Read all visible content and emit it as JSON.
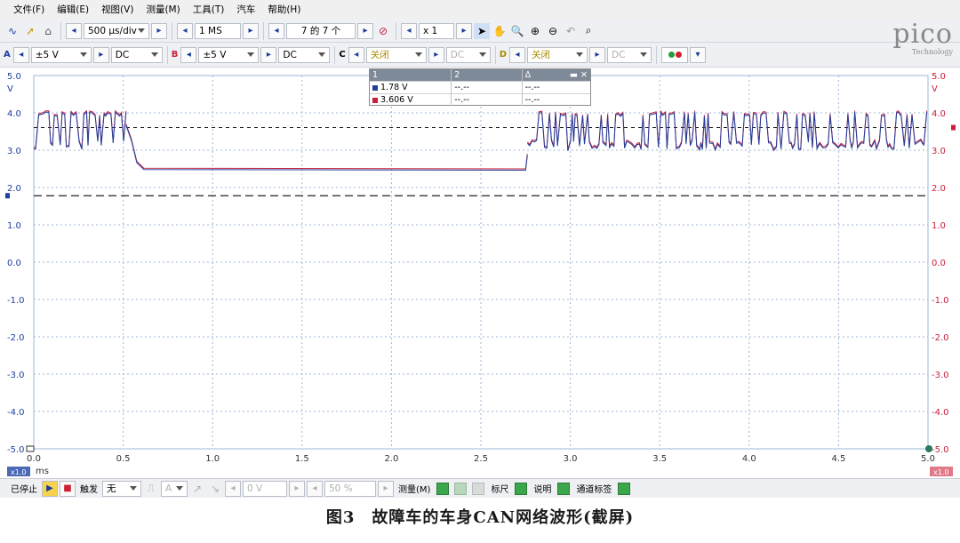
{
  "menu": [
    "文件(F)",
    "编辑(E)",
    "视图(V)",
    "测量(M)",
    "工具(T)",
    "汽车",
    "帮助(H)"
  ],
  "toolbar1": {
    "timebase": "500 µs/div",
    "samples": "1 MS",
    "buffer": "7 的 7 个",
    "zoom": "x 1"
  },
  "toolbar2": {
    "chA": {
      "label": "A",
      "range": "±5 V",
      "coupling": "DC",
      "color": "#1f3f9e"
    },
    "chB": {
      "label": "B",
      "range": "±5 V",
      "coupling": "DC",
      "color": "#c8203c"
    },
    "chC": {
      "label": "C",
      "state": "关闭",
      "coupling": "DC"
    },
    "chD": {
      "label": "D",
      "state": "关闭",
      "coupling": "DC"
    }
  },
  "logo": {
    "name": "pico",
    "sub": "Technology"
  },
  "measurements": {
    "headers": [
      "1",
      "2",
      "Δ"
    ],
    "rows": [
      {
        "c1": "1.78 V",
        "c2": "--.--",
        "c3": "--.--",
        "color": "#1f3f9e"
      },
      {
        "c1": "3.606 V",
        "c2": "--.--",
        "c3": "--.--",
        "color": "#c8203c"
      }
    ]
  },
  "axes": {
    "y_ticks": [
      "5.0",
      "4.0",
      "3.0",
      "2.0",
      "1.0",
      "0.0",
      "-1.0",
      "-2.0",
      "-3.0",
      "-4.0",
      "-5.0"
    ],
    "y_unit": "V",
    "x_ticks": [
      "0.0",
      "0.5",
      "1.0",
      "1.5",
      "2.0",
      "2.5",
      "3.0",
      "3.5",
      "4.0",
      "4.5",
      "5.0"
    ],
    "x_unit": "ms",
    "x_zoom": "x1.0",
    "y_zoom": "x1.0"
  },
  "rulers": {
    "level1": 1.78,
    "level2": 3.606
  },
  "signal": {
    "burst1": [
      0.0,
      0.52
    ],
    "idle_level": 2.5,
    "burst2": [
      2.76,
      5.0
    ],
    "high": 4.0,
    "low": 3.0,
    "colors": {
      "A": "#1f3f9e",
      "B": "#c8203c"
    }
  },
  "status": {
    "state": "已停止",
    "trigger_label": "触发",
    "trigger_mode": "无",
    "trigger_ch": "A",
    "trigger_level": "0 V",
    "pretrigger": "50 %",
    "measure": "测量(M)",
    "ruler": "标尺",
    "notes": "说明",
    "channel_labels": "通道标签"
  },
  "caption": "图3　故障车的车身CAN网络波形(截屏)"
}
